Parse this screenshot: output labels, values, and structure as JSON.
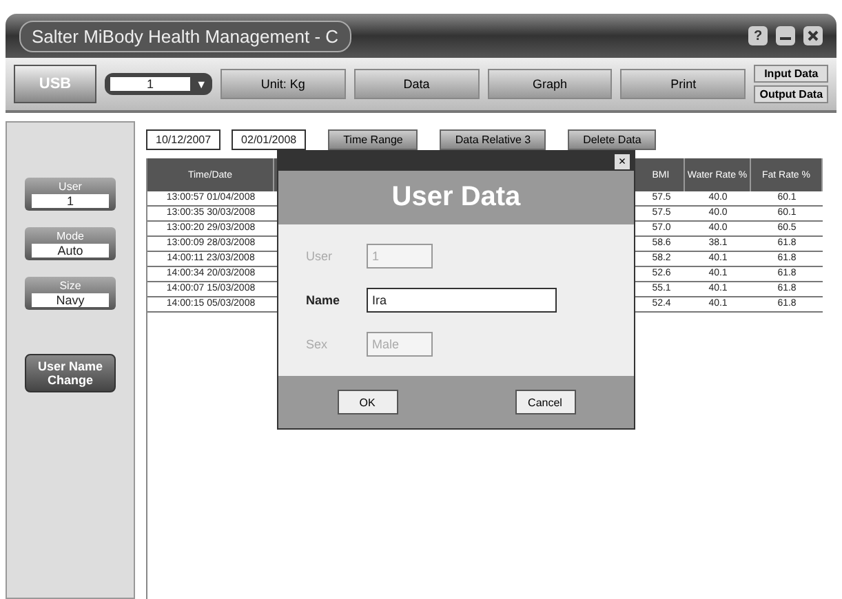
{
  "window": {
    "title": "Salter MiBody Health Management - C",
    "help": "?"
  },
  "toolbar": {
    "usb": "USB",
    "user_select": {
      "value": "1",
      "arrow": "▼"
    },
    "tabs": [
      {
        "label": "Unit: Kg",
        "selected": false
      },
      {
        "label": "Data",
        "selected": false
      },
      {
        "label": "Graph",
        "selected": false
      },
      {
        "label": "Print",
        "selected": false
      }
    ],
    "side_buttons": [
      "Input Data",
      "Output Data"
    ]
  },
  "sidebar": {
    "fields": [
      {
        "label": "User",
        "value": "1"
      },
      {
        "label": "Mode",
        "value": "Auto"
      },
      {
        "label": "Size",
        "value": "Navy"
      }
    ],
    "action": "User Name Change"
  },
  "filter": {
    "from": "10/12/2007",
    "to": "02/01/2008",
    "buttons": [
      "Time Range",
      "Data Relative 3",
      "Delete Data"
    ]
  },
  "table": {
    "columns": [
      "Time/Date",
      "BMI",
      "Water Rate %",
      "Fat Rate %"
    ],
    "rows": [
      [
        "13:00:57 01/04/2008",
        "57.5",
        "40.0",
        "60.1"
      ],
      [
        "13:00:35 30/03/2008",
        "57.5",
        "40.0",
        "60.1"
      ],
      [
        "13:00:20 29/03/2008",
        "57.0",
        "40.0",
        "60.5"
      ],
      [
        "13:00:09 28/03/2008",
        "58.6",
        "38.1",
        "61.8"
      ],
      [
        "14:00:11 23/03/2008",
        "58.2",
        "40.1",
        "61.8"
      ],
      [
        "14:00:34 20/03/2008",
        "52.6",
        "40.1",
        "61.8"
      ],
      [
        "14:00:07 15/03/2008",
        "55.1",
        "40.1",
        "61.8"
      ],
      [
        "14:00:15 05/03/2008",
        "52.4",
        "40.1",
        "61.8"
      ]
    ]
  },
  "dialog": {
    "close": "×",
    "title": "User Data",
    "fields": [
      {
        "label": "User",
        "value": "1",
        "disabled": true
      },
      {
        "label": "Name",
        "value": "Ira",
        "disabled": false
      },
      {
        "label": "Sex",
        "value": "Male",
        "disabled": true
      }
    ],
    "buttons": [
      "OK",
      "Cancel"
    ]
  }
}
